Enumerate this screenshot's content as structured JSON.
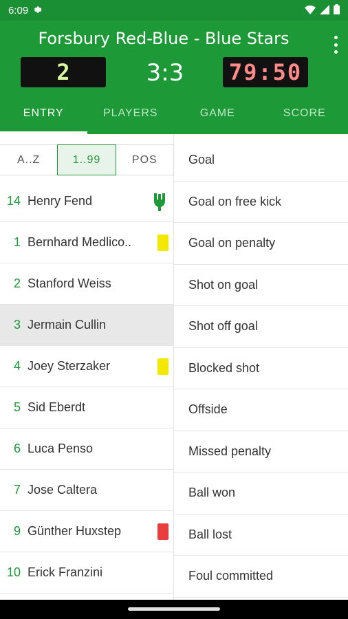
{
  "status_bar": {
    "time": "6:09",
    "icons": [
      "gear-icon",
      "wifi-icon",
      "signal-icon",
      "battery-icon"
    ]
  },
  "header": {
    "title": "Forsbury Red-Blue - Blue Stars",
    "period": "2",
    "score": "3:3",
    "clock": "79:50"
  },
  "tabs": [
    {
      "label": "ENTRY",
      "active": true
    },
    {
      "label": "PLAYERS",
      "active": false
    },
    {
      "label": "GAME",
      "active": false
    },
    {
      "label": "SCORE",
      "active": false
    }
  ],
  "sorter": [
    "A..Z",
    "1..99",
    "POS"
  ],
  "players": [
    {
      "number": "14",
      "name": "Henry Fend",
      "marker": "goalkeeper-icon"
    },
    {
      "number": "1",
      "name": "Bernhard Medlico..",
      "marker": "yellow-card"
    },
    {
      "number": "2",
      "name": "Stanford Weiss",
      "marker": ""
    },
    {
      "number": "3",
      "name": "Jermain Cullin",
      "marker": "",
      "selected": true
    },
    {
      "number": "4",
      "name": "Joey Sterzaker",
      "marker": "yellow-card"
    },
    {
      "number": "5",
      "name": "Sid Eberdt",
      "marker": ""
    },
    {
      "number": "6",
      "name": "Luca Penso",
      "marker": ""
    },
    {
      "number": "7",
      "name": "Jose Caltera",
      "marker": ""
    },
    {
      "number": "9",
      "name": "Günther Huxstep",
      "marker": "red-card"
    },
    {
      "number": "10",
      "name": "Erick Franzini",
      "marker": ""
    }
  ],
  "actions": [
    "Goal",
    "Goal on free kick",
    "Goal on penalty",
    "Shot on goal",
    "Shot off goal",
    "Blocked shot",
    "Offside",
    "Missed penalty",
    "Ball won",
    "Ball lost",
    "Foul committed"
  ],
  "colors": {
    "primary": "#1d9937",
    "status_bar": "#1b8f34",
    "yellow_card": "#f2e800",
    "red_card": "#ea3e3e"
  }
}
